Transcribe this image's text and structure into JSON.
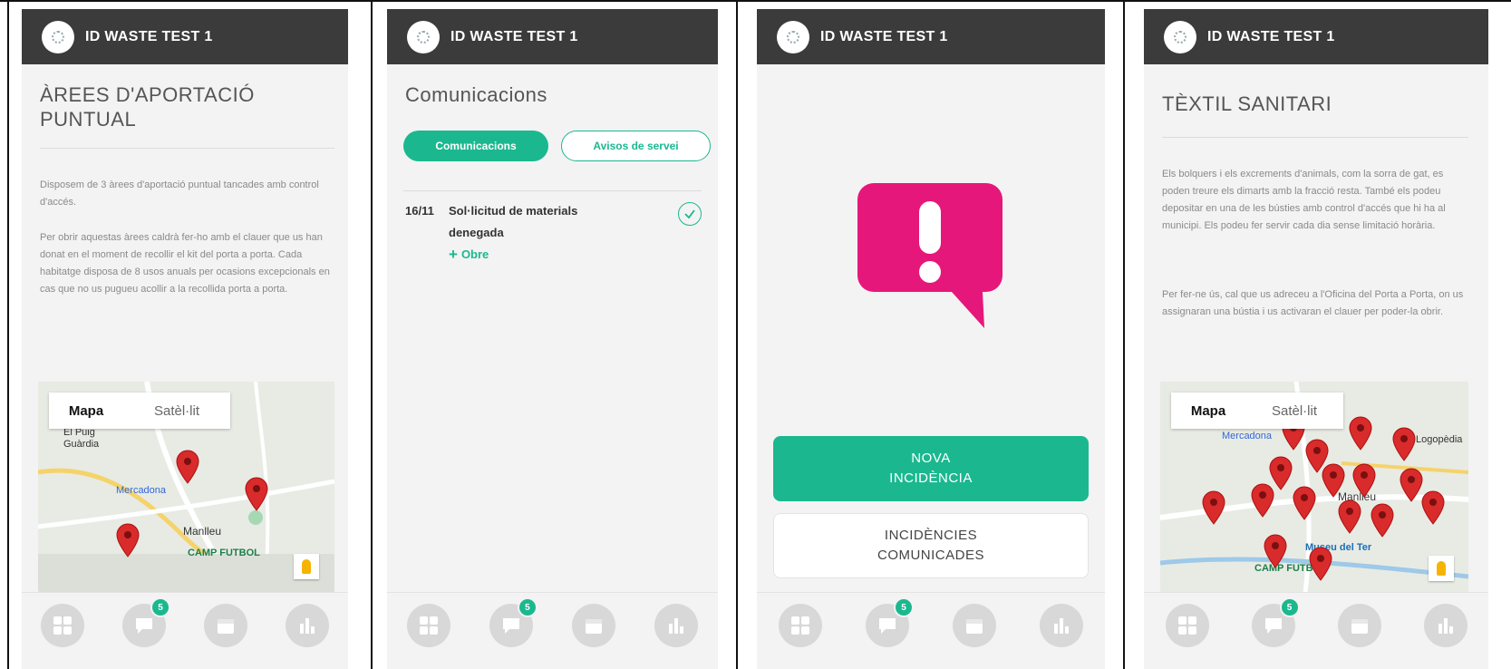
{
  "app": {
    "name": "ID WASTE TEST 1"
  },
  "colors": {
    "accent": "#1bb88f",
    "header_bg": "#3b3b3b",
    "alert_pink": "#e6177a",
    "pin_red": "#d92b2b"
  },
  "screen1": {
    "heading_line1": "ÀREES D'APORTACIÓ",
    "heading_line2": "PUNTUAL",
    "paragraph1": "Disposem de 3 àrees d'aportació puntual tancades amb control d'accés.",
    "paragraph2": "Per obrir aquestas àrees caldrà fer-ho amb el clauer que us han donat en el moment de recollir el kit del porta a porta. Cada habitatge disposa de 8 usos anuals per ocasions excepcionals en cas que no us pugueu acollir a la recollida porta a porta.",
    "map": {
      "toggle_map": "Mapa",
      "toggle_satellite": "Satèl·lit",
      "label_puig": "El Puig",
      "label_guardia": "Guàrdia",
      "label_mercadona": "Mercadona",
      "label_town": "Manlleu",
      "label_field": "CAMP FUTBOL"
    }
  },
  "screen2": {
    "heading": "Comunicacions",
    "tabs": {
      "communications": "Comunicacions",
      "service_notices": "Avisos de servei"
    },
    "items": [
      {
        "date": "16/11",
        "title_line1": "Sol·licitud de materials",
        "title_line2": "denegada",
        "more": "Obre"
      }
    ]
  },
  "screen3": {
    "new_incident_line1": "NOVA",
    "new_incident_line2": "INCIDÈNCIA",
    "reported_line1": "INCIDÈNCIES",
    "reported_line2": "COMUNICADES"
  },
  "screen4": {
    "heading": "TÈXTIL SANITARI",
    "paragraph1": "Els bolquers i els excrements d'animals, com la sorra de gat, es poden treure els dimarts amb la fracció resta. També els podeu depositar en una de les bústies amb control d'accés que hi ha al municipi. Els podeu fer servir cada dia sense limitació horària.",
    "paragraph2": "Per fer-ne ús, cal que us adreceu a l'Oficina del Porta a Porta, on us assignaran una bústia i us activaran el clauer per poder-la obrir.",
    "map": {
      "toggle_map": "Mapa",
      "toggle_satellite": "Satèl·lit",
      "label_town": "Manlleu",
      "label_museum": "Museu del Ter",
      "label_field": "CAMP FUTBOL",
      "label_mercadona": "Mercadona",
      "label_logopedia": "Logopèdia"
    }
  },
  "nav": {
    "badge_count": "5",
    "items": [
      "grid-icon",
      "chat-icon",
      "calendar-icon",
      "chart-icon"
    ]
  }
}
